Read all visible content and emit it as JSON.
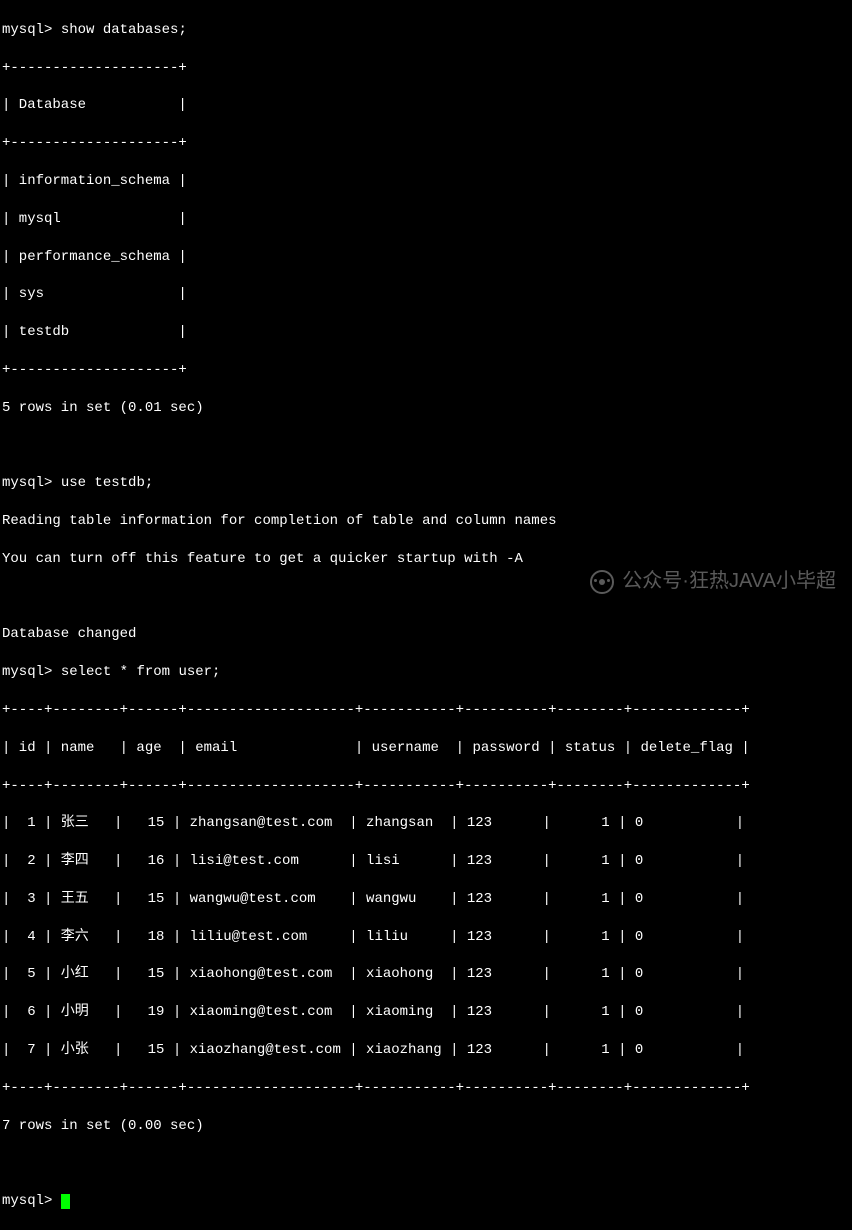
{
  "session": {
    "prompt": "mysql>",
    "cmd_show_databases": "show databases;",
    "db_header_border": "+--------------------+",
    "db_header": "| Database           |",
    "databases": [
      "| information_schema |",
      "| mysql              |",
      "| performance_schema |",
      "| sys                |",
      "| testdb             |"
    ],
    "db_count_msg": "5 rows in set (0.01 sec)",
    "cmd_use": "use testdb;",
    "use_msg1": "Reading table information for completion of table and column names",
    "use_msg2": "You can turn off this feature to get a quicker startup with -A",
    "db_changed": "Database changed",
    "cmd_select": "select * from user;",
    "user_border": "+----+--------+------+--------------------+-----------+----------+--------+-------------+",
    "user_header": "| id | name   | age  | email              | username  | password | status | delete_flag |",
    "user_rows": [
      "|  1 | 张三   |   15 | zhangsan@test.com  | zhangsan  | 123      |      1 | 0           |",
      "|  2 | 李四   |   16 | lisi@test.com      | lisi      | 123      |      1 | 0           |",
      "|  3 | 王五   |   15 | wangwu@test.com    | wangwu    | 123      |      1 | 0           |",
      "|  4 | 李六   |   18 | liliu@test.com     | liliu     | 123      |      1 | 0           |",
      "|  5 | 小红   |   15 | xiaohong@test.com  | xiaohong  | 123      |      1 | 0           |",
      "|  6 | 小明   |   19 | xiaoming@test.com  | xiaoming  | 123      |      1 | 0           |",
      "|  7 | 小张   |   15 | xiaozhang@test.com | xiaozhang | 123      |      1 | 0           |"
    ],
    "user_count_msg": "7 rows in set (0.00 sec)",
    "watermark_text": "公众号·狂热JAVA小毕超"
  },
  "chart_data": {
    "type": "table",
    "title": "user",
    "columns": [
      "id",
      "name",
      "age",
      "email",
      "username",
      "password",
      "status",
      "delete_flag"
    ],
    "rows": [
      [
        1,
        "张三",
        15,
        "zhangsan@test.com",
        "zhangsan",
        "123",
        1,
        0
      ],
      [
        2,
        "李四",
        16,
        "lisi@test.com",
        "lisi",
        "123",
        1,
        0
      ],
      [
        3,
        "王五",
        15,
        "wangwu@test.com",
        "wangwu",
        "123",
        1,
        0
      ],
      [
        4,
        "李六",
        18,
        "liliu@test.com",
        "liliu",
        "123",
        1,
        0
      ],
      [
        5,
        "小红",
        15,
        "xiaohong@test.com",
        "xiaohong",
        "123",
        1,
        0
      ],
      [
        6,
        "小明",
        19,
        "xiaoming@test.com",
        "xiaoming",
        "123",
        1,
        0
      ],
      [
        7,
        "小张",
        15,
        "xiaozhang@test.com",
        "xiaozhang",
        "123",
        1,
        0
      ]
    ],
    "databases_list": [
      "information_schema",
      "mysql",
      "performance_schema",
      "sys",
      "testdb"
    ]
  }
}
